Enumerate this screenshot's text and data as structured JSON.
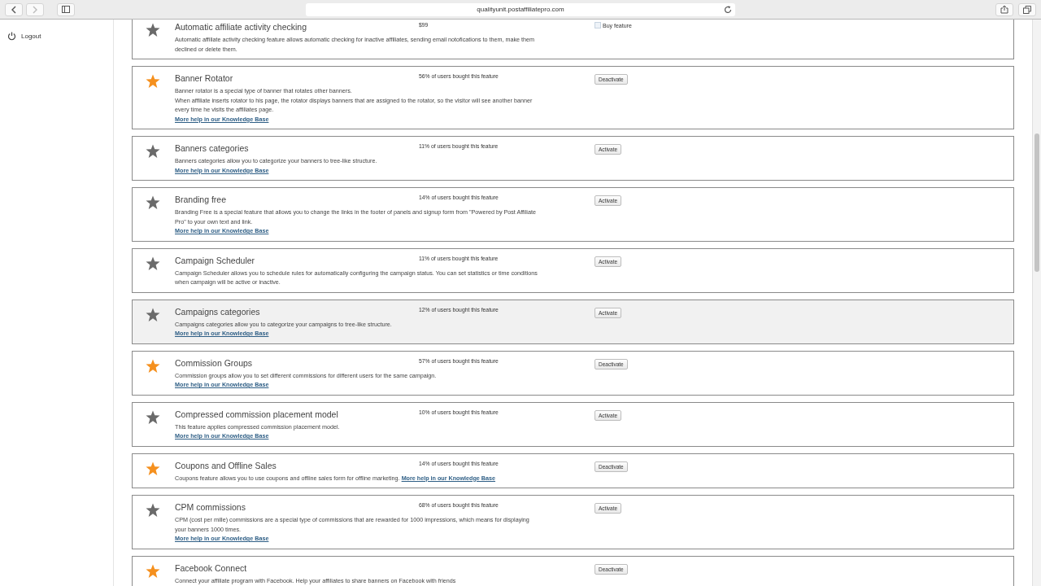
{
  "browser": {
    "url": "qualityunit.postaffiliatepro.com"
  },
  "sidebar": {
    "items": [
      {
        "label": "Logout",
        "kind": "logout"
      }
    ]
  },
  "features": [
    {
      "name": "Automatic affiliate activity checking",
      "active": false,
      "hovered": false,
      "price": "$99",
      "description": [
        "Automatic affiliate activity checking feature allows automatic checking for inactive affiliates, sending email notofications to them, make them declined or delete them."
      ],
      "action": {
        "kind": "buy",
        "label": "Buy feature"
      }
    },
    {
      "name": "Banner Rotator",
      "active": true,
      "hovered": false,
      "stat": "56% of users bought this feature",
      "description": [
        "Banner rotator is a special type of banner that rotates other banners.",
        "When affiliate inserts rotator to his page, the rotator displays banners that are assigned to the rotator, so the visitor will see another banner every time he visits the affiliates page."
      ],
      "link": "More help in our Knowledge Base",
      "action": {
        "kind": "button",
        "label": "Deactivate"
      }
    },
    {
      "name": "Banners categories",
      "active": false,
      "hovered": false,
      "stat": "11% of users bought this feature",
      "description": [
        "Banners categories allow you to categorize your banners to tree-like structure."
      ],
      "link": "More help in our Knowledge Base",
      "action": {
        "kind": "button",
        "label": "Activate"
      }
    },
    {
      "name": "Branding free",
      "active": false,
      "hovered": false,
      "stat": "14% of users bought this feature",
      "description": [
        "Branding Free is a special feature that allows you to change the links in the footer of panels and signup form from \"Powered by Post Affiliate Pro\" to your own text and link."
      ],
      "link": "More help in our Knowledge Base",
      "action": {
        "kind": "button",
        "label": "Activate"
      }
    },
    {
      "name": "Campaign Scheduler",
      "active": false,
      "hovered": false,
      "stat": "11% of users bought this feature",
      "description": [
        "Campaign Scheduler allows you to schedule rules for automatically configuring the campaign status. You can set statistics or time conditions when campaign will be active or inactive."
      ],
      "action": {
        "kind": "button",
        "label": "Activate"
      }
    },
    {
      "name": "Campaigns categories",
      "active": false,
      "hovered": true,
      "stat": "12% of users bought this feature",
      "description": [
        "Campaigns categories allow you to categorize your campaigns to tree-like structure."
      ],
      "link": "More help in our Knowledge Base",
      "action": {
        "kind": "button",
        "label": "Activate"
      }
    },
    {
      "name": "Commission Groups",
      "active": true,
      "hovered": false,
      "stat": "57% of users bought this feature",
      "description": [
        "Commission groups allow you to set different commissions for different users for the same campaign."
      ],
      "link": "More help in our Knowledge Base",
      "action": {
        "kind": "button",
        "label": "Deactivate"
      }
    },
    {
      "name": "Compressed commission placement model",
      "active": false,
      "hovered": false,
      "stat": "10% of users bought this feature",
      "description": [
        "This feature applies compressed commission placement model."
      ],
      "link": "More help in our Knowledge Base",
      "action": {
        "kind": "button",
        "label": "Activate"
      }
    },
    {
      "name": "Coupons and Offline Sales",
      "active": true,
      "hovered": false,
      "stat": "14% of users bought this feature",
      "description": [
        "Coupons feature allows you to use coupons and offline sales form for offline marketing."
      ],
      "link": "More help in our Knowledge Base",
      "link_inline": true,
      "action": {
        "kind": "button",
        "label": "Deactivate"
      }
    },
    {
      "name": "CPM commissions",
      "active": false,
      "hovered": false,
      "stat": "68% of users bought this feature",
      "description": [
        "CPM (cost per mille) commissions are a special type of commissions that are rewarded for 1000 impressions, which means for displaying your banners 1000 times."
      ],
      "link": "More help in our Knowledge Base",
      "action": {
        "kind": "button",
        "label": "Activate"
      }
    },
    {
      "name": "Facebook Connect",
      "active": true,
      "hovered": false,
      "description": [
        "Connect your affiliate program with Facebook. Help your affiliates to share banners on Facebook with friends"
      ],
      "action": {
        "kind": "button",
        "label": "Deactivate"
      }
    }
  ]
}
